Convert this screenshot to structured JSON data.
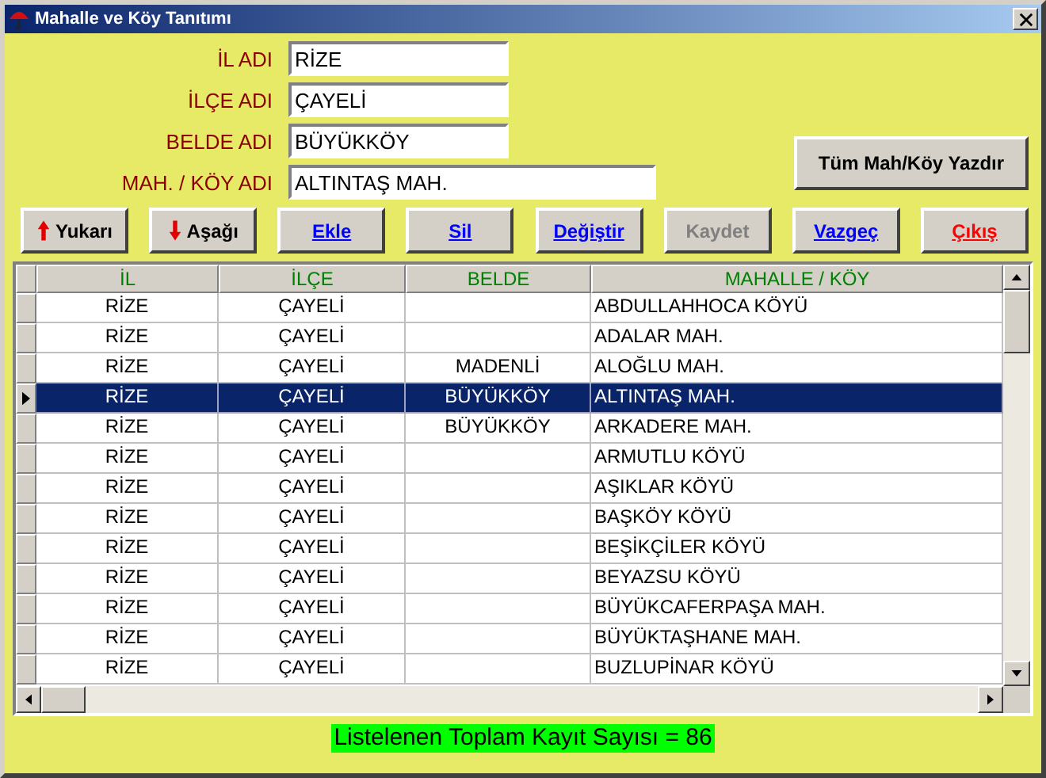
{
  "window": {
    "title": "Mahalle ve Köy Tanıtımı"
  },
  "form": [
    {
      "label": "İL ADI",
      "value": "RİZE",
      "kind": "short"
    },
    {
      "label": "İLÇE ADI",
      "value": "ÇAYELİ",
      "kind": "short"
    },
    {
      "label": "BELDE ADI",
      "value": "BÜYÜKKÖY",
      "kind": "short"
    },
    {
      "label": "MAH. / KÖY ADI",
      "value": "ALTINTAŞ MAH.",
      "kind": "long"
    }
  ],
  "print_button": "Tüm Mah/Köy Yazdır",
  "buttons": [
    {
      "label": "Yukarı",
      "kind": "up",
      "color": "#000000",
      "disabled": false
    },
    {
      "label": "Aşağı",
      "kind": "down",
      "color": "#000000",
      "disabled": false
    },
    {
      "label": "Ekle",
      "kind": "text",
      "color": "#0000ff",
      "disabled": false
    },
    {
      "label": "Sil",
      "kind": "text",
      "color": "#0000ff",
      "disabled": false
    },
    {
      "label": "Değiştir",
      "kind": "text",
      "color": "#0000ff",
      "disabled": false
    },
    {
      "label": "Kaydet",
      "kind": "text",
      "disabled": true
    },
    {
      "label": "Vazgeç",
      "kind": "text",
      "color": "#0000ff",
      "disabled": false
    },
    {
      "label": "Çıkış",
      "kind": "text",
      "color": "#ff0000",
      "disabled": false
    }
  ],
  "table": {
    "columns": [
      "İL",
      "İLÇE",
      "BELDE",
      "MAHALLE / KÖY"
    ],
    "rows": [
      {
        "cells": [
          "RİZE",
          "ÇAYELİ",
          "",
          "ABDULLAHHOCA KÖYÜ"
        ],
        "selected": false
      },
      {
        "cells": [
          "RİZE",
          "ÇAYELİ",
          "",
          "ADALAR MAH."
        ],
        "selected": false
      },
      {
        "cells": [
          "RİZE",
          "ÇAYELİ",
          "MADENLİ",
          "ALOĞLU MAH."
        ],
        "selected": false
      },
      {
        "cells": [
          "RİZE",
          "ÇAYELİ",
          "BÜYÜKKÖY",
          "ALTINTAŞ MAH."
        ],
        "selected": true
      },
      {
        "cells": [
          "RİZE",
          "ÇAYELİ",
          "BÜYÜKKÖY",
          "ARKADERE MAH."
        ],
        "selected": false
      },
      {
        "cells": [
          "RİZE",
          "ÇAYELİ",
          "",
          "ARMUTLU KÖYÜ"
        ],
        "selected": false
      },
      {
        "cells": [
          "RİZE",
          "ÇAYELİ",
          "",
          "AŞIKLAR KÖYÜ"
        ],
        "selected": false
      },
      {
        "cells": [
          "RİZE",
          "ÇAYELİ",
          "",
          "BAŞKÖY KÖYÜ"
        ],
        "selected": false
      },
      {
        "cells": [
          "RİZE",
          "ÇAYELİ",
          "",
          "BEŞİKÇİLER KÖYÜ"
        ],
        "selected": false
      },
      {
        "cells": [
          "RİZE",
          "ÇAYELİ",
          "",
          "BEYAZSU KÖYÜ"
        ],
        "selected": false
      },
      {
        "cells": [
          "RİZE",
          "ÇAYELİ",
          "",
          "BÜYÜKCAFERPAŞA MAH."
        ],
        "selected": false
      },
      {
        "cells": [
          "RİZE",
          "ÇAYELİ",
          "",
          "BÜYÜKTAŞHANE MAH."
        ],
        "selected": false
      },
      {
        "cells": [
          "RİZE",
          "ÇAYELİ",
          "",
          "BUZLUPİNAR KÖYÜ"
        ],
        "selected": false
      }
    ]
  },
  "status": "Listelenen Toplam Kayıt Sayısı =  86"
}
